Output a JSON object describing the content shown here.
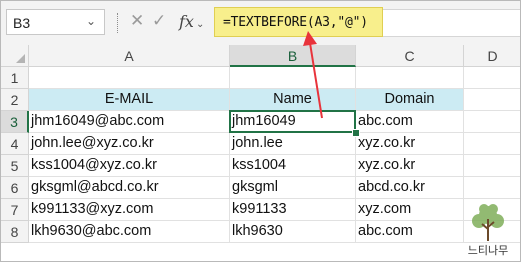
{
  "name_box": {
    "value": "B3",
    "dropdown_glyph": "⌄"
  },
  "formula_bar": {
    "cancel_glyph": "✕",
    "enter_glyph": "✓",
    "fx_label": "fx",
    "fx_arrow": "⌄",
    "formula": "=TEXTBEFORE(A3,\"@\")"
  },
  "sheet": {
    "columns": [
      "A",
      "B",
      "C",
      "D"
    ],
    "rows": [
      "1",
      "2",
      "3",
      "4",
      "5",
      "6",
      "7",
      "8"
    ],
    "selected_column": "B",
    "selected_row": "3",
    "headers": {
      "email": "E-MAIL",
      "name": "Name",
      "domain": "Domain"
    },
    "data": [
      [
        "jhm16049@abc.com",
        "jhm16049",
        "abc.com"
      ],
      [
        "john.lee@xyz.co.kr",
        "john.lee",
        "xyz.co.kr"
      ],
      [
        "kss1004@xyz.co.kr",
        "kss1004",
        "xyz.co.kr"
      ],
      [
        "gksgml@abcd.co.kr",
        "gksgml",
        "abcd.co.kr"
      ],
      [
        "k991133@xyz.com",
        "k991133",
        "xyz.com"
      ],
      [
        "lkh9630@abc.com",
        "lkh9630",
        "abc.com"
      ]
    ]
  },
  "watermark": {
    "text": "느티나무"
  },
  "colors": {
    "header_fill": "#ccebf3",
    "formula_highlight": "#f8ef8c",
    "selection": "#217346",
    "annotation_arrow": "#e8333b"
  }
}
